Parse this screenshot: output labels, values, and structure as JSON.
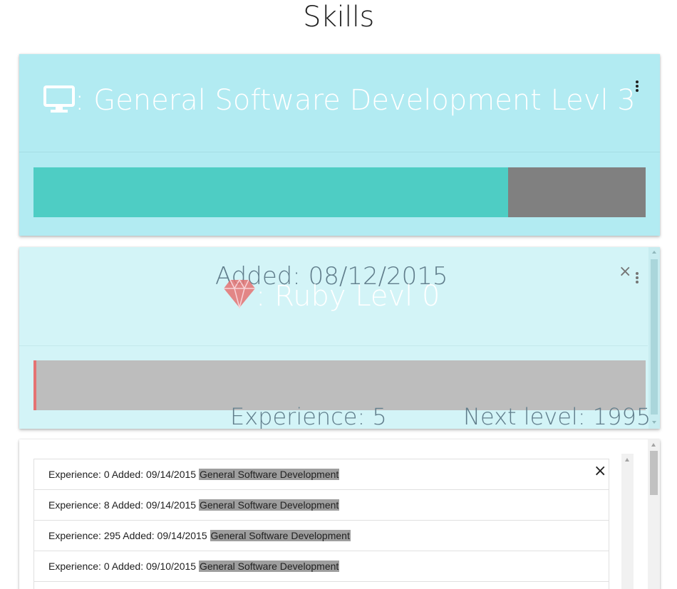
{
  "page": {
    "title": "Skills"
  },
  "cards": [
    {
      "title": ": General Software Development Levl 3",
      "icon": "monitor-icon",
      "progress_fraction": 0.775,
      "progress_color": "#4ecdc4",
      "card_color": "#b2ebf2"
    },
    {
      "added_text": "Added: 08/12/2015",
      "title": ": Ruby Levl 0",
      "icon": "ruby-icon",
      "close_label": "×",
      "progress_fraction": 0.0025,
      "progress_color": "#e57373",
      "card_color": "#d3f4f7",
      "experience_text": "Experience: 5",
      "next_level_text": "Next level: 1995"
    }
  ],
  "history": {
    "close_label": "×",
    "items": [
      {
        "text": "Experience: 0 Added: 09/14/2015 ",
        "skill": "General Software Development"
      },
      {
        "text": "Experience: 8 Added: 09/14/2015 ",
        "skill": "General Software Development"
      },
      {
        "text": "Experience: 295 Added: 09/14/2015 ",
        "skill": "General Software Development"
      },
      {
        "text": "Experience: 0 Added: 09/10/2015 ",
        "skill": "General Software Development"
      },
      {
        "text": "",
        "skill": ""
      }
    ]
  }
}
